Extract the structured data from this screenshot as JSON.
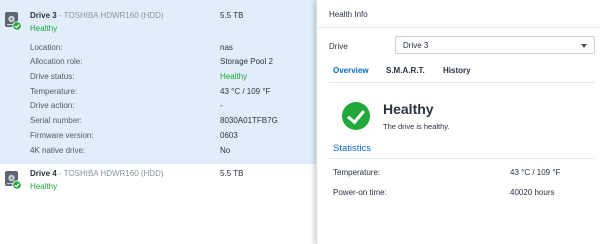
{
  "drives": [
    {
      "number": "Drive 3",
      "separator": " - ",
      "model": "TOSHIBA HDWR160 (HDD)",
      "status": "Healthy",
      "size": "5.5 TB",
      "details": [
        {
          "label": "Location:",
          "value": "nas"
        },
        {
          "label": "Allocation role:",
          "value": "Storage Pool 2"
        },
        {
          "label": "Drive status:",
          "value": "Healthy"
        },
        {
          "label": "Temperature:",
          "value": "43 °C / 109 °F"
        },
        {
          "label": "Drive action:",
          "value": "-"
        },
        {
          "label": "Serial number:",
          "value": "8030A01TFB7G"
        },
        {
          "label": "Firmware version:",
          "value": "0603"
        },
        {
          "label": "4K native drive:",
          "value": "No"
        }
      ]
    },
    {
      "number": "Drive 4",
      "separator": " - ",
      "model": "TOSHIBA HDWR160 (HDD)",
      "status": "Healthy",
      "size": "5.5 TB"
    }
  ],
  "panel": {
    "title": "Health Info",
    "drive_label": "Drive",
    "drive_selected": "Drive 3",
    "tabs": [
      {
        "label": "Overview",
        "active": true
      },
      {
        "label": "S.M.A.R.T.",
        "active": false
      },
      {
        "label": "History",
        "active": false
      }
    ],
    "health_title": "Healthy",
    "health_desc": "The drive is healthy.",
    "stats_heading": "Statistics",
    "stats": [
      {
        "label": "Temperature:",
        "value": "43 °C / 109 °F"
      },
      {
        "label": "Power-on time:",
        "value": "40020 hours"
      }
    ]
  },
  "colors": {
    "selected_bg": "#e1eefa",
    "healthy_green": "#1aa83a",
    "accent_blue": "#0a6cc4"
  }
}
